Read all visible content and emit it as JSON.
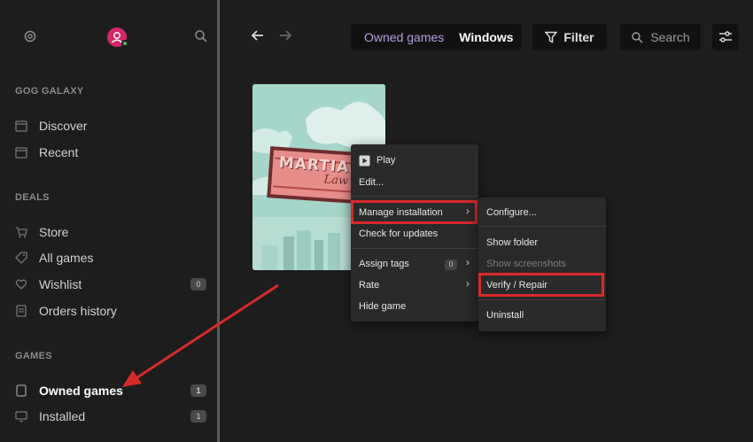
{
  "sidebar": {
    "brand": "GOG GALAXY",
    "brand_items": [
      {
        "label": "Discover",
        "icon": "discover-icon"
      },
      {
        "label": "Recent",
        "icon": "recent-icon"
      }
    ],
    "deals_title": "DEALS",
    "deals_items": [
      {
        "label": "Store",
        "icon": "cart-icon"
      },
      {
        "label": "All games",
        "icon": "tag-icon"
      },
      {
        "label": "Wishlist",
        "icon": "heart-icon",
        "badge": "0"
      },
      {
        "label": "Orders history",
        "icon": "receipt-icon"
      }
    ],
    "games_title": "GAMES",
    "games_items": [
      {
        "label": "Owned games",
        "icon": "owned-games-icon",
        "badge": "1"
      },
      {
        "label": "Installed",
        "icon": "installed-icon",
        "badge": "1"
      }
    ]
  },
  "topbar": {
    "owned_label": "Owned games",
    "platform_label": "Windows",
    "filter_label": "Filter",
    "search_label": "Search"
  },
  "game": {
    "cover_title_line1": "MARTIAL",
    "cover_title_line2": "Law"
  },
  "context_menu": {
    "play": "Play",
    "edit": "Edit...",
    "manage": "Manage installation",
    "check_updates": "Check for updates",
    "assign_tags": "Assign tags",
    "tags_count": "0",
    "rate": "Rate",
    "hide": "Hide game"
  },
  "submenu": {
    "configure": "Configure...",
    "show_folder": "Show folder",
    "show_screenshots": "Show screenshots",
    "verify": "Verify / Repair",
    "uninstall": "Uninstall"
  },
  "colors": {
    "accent_purple": "#b39ddf",
    "highlight_red": "#d72a2a",
    "avatar_pink": "#d6266a"
  }
}
